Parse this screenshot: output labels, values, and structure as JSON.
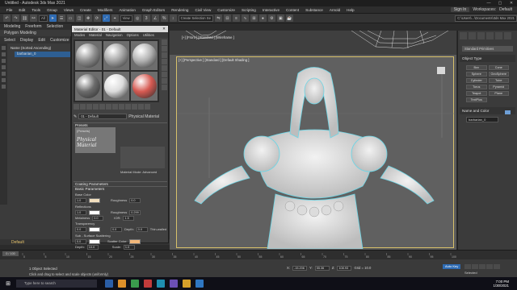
{
  "window": {
    "title": "Untitled - Autodesk 3ds Max 2021",
    "controls": [
      "—",
      "▢",
      "✕"
    ]
  },
  "menubar": {
    "items": [
      "File",
      "Edit",
      "Tools",
      "Group",
      "Views",
      "Create",
      "Modifiers",
      "Animation",
      "Graph Editors",
      "Rendering",
      "Civil View",
      "Customize",
      "Scripting",
      "Interactive",
      "Content",
      "Substance",
      "Arnold",
      "Help"
    ],
    "signin": "Sign In",
    "workspaces_label": "Workspaces:",
    "workspace_value": "Default"
  },
  "toolbar": {
    "view_select": "All",
    "view_mode": "View",
    "selection_set": "Create Selection Se",
    "path": "C:\\Users\\...\\Documents\\3ds Max 2021"
  },
  "ribbon": {
    "tabs": [
      "Modeling",
      "Freeform",
      "Selection",
      "Object Paint",
      "Populate"
    ],
    "sub": "Polygon Modeling"
  },
  "scene_explorer": {
    "tabs": [
      "Select",
      "Display",
      "Edit",
      "Customize"
    ],
    "rows": [
      {
        "label": "Name (Sorted Ascending)",
        "selected": false
      },
      {
        "label": "barbarian_0",
        "selected": true
      }
    ],
    "footer": "Default"
  },
  "material_editor": {
    "title": "Material Editor - 01 - Default",
    "menu": [
      "Modes",
      "Material",
      "Navigation",
      "Options",
      "Utilities"
    ],
    "material_name": "01 - Default",
    "material_type": "Physical Material",
    "rollouts": {
      "presets": "Presets",
      "preset_value": "(Presets)",
      "thumb_text": "Physical\nMaterial",
      "material_mode_label": "Material Mode:",
      "material_mode_value": "Advanced",
      "coating": "Coating Parameters",
      "basic": "Basic Parameters",
      "base_color": "Base Color",
      "reflections": "Reflections",
      "transparency": "Transparency",
      "sss": "Sub - Surface Scattering",
      "emission": "Emission"
    },
    "params": {
      "base_weight": "1.0",
      "roughness_label": "Roughness",
      "roughness": "0.0",
      "refl_weight": "1.0",
      "refl_roughness_label": "Roughness",
      "refl_roughness": "0.299",
      "metalness_label": "Metalness",
      "metalness": "0.0",
      "ior_label": "IOR:",
      "ior": "1.5",
      "trans_weight": "0.0",
      "trans_roughness": "0.0",
      "depth_label": "Depth:",
      "depth": "0.0",
      "thin_walled": "Thin-walled",
      "sss_weight": "0.0",
      "scatter_color_label": "Scatter Color:",
      "sss_depth": "10.0",
      "scale_label": "Scale:",
      "scale": "1.0",
      "emission_weight": "1.0"
    },
    "slot_colors": [
      "#8f8f8f",
      "#a4a4a4",
      "#b2b2b2",
      "#6c6c6c",
      "#dcdcdc",
      "#d65a52"
    ]
  },
  "viewport": {
    "top_label": "[+] [Front ] [Standard ] [Wireframe ]",
    "persp_label": "[+] [Perspective ] [Standard ] [Default Shading ]",
    "border_color": "#d7c06a"
  },
  "command_panel": {
    "dropdown": "Standard Primitives",
    "object_type": "Object Type",
    "objects": [
      "Box",
      "Cone",
      "Sphere",
      "GeoSphere",
      "Cylinder",
      "Tube",
      "Torus",
      "Pyramid",
      "Teapot",
      "Plane",
      "TextPlus"
    ],
    "name_color": "Name and Color",
    "name_value": "barbarian_0",
    "color": "#6e9fd6"
  },
  "timeline": {
    "frame": "0 / 100",
    "ticks": [
      "0",
      "5",
      "10",
      "15",
      "20",
      "25",
      "30",
      "35",
      "40",
      "45",
      "50",
      "55",
      "60",
      "65",
      "70",
      "75",
      "80",
      "85",
      "90",
      "95",
      "100"
    ]
  },
  "status": {
    "selected": "1 Object Selected",
    "hint": "Click and drag to select and scale objects (uniformly)",
    "x": "-15.206",
    "y": "55.36",
    "z": "108.93",
    "grid": "Grid = 10.0",
    "autokey": "Auto Key",
    "setkey": "Selected"
  },
  "taskbar": {
    "search": "Type here to search",
    "time": "7:00 PM",
    "date": "1/30/2021",
    "app_colors": [
      "#2b5ea7",
      "#dd8f2a",
      "#3a9a4d",
      "#c23b3b",
      "#1f8fb0",
      "#6c4fb5",
      "#d6a02a",
      "#2f77c2"
    ]
  }
}
